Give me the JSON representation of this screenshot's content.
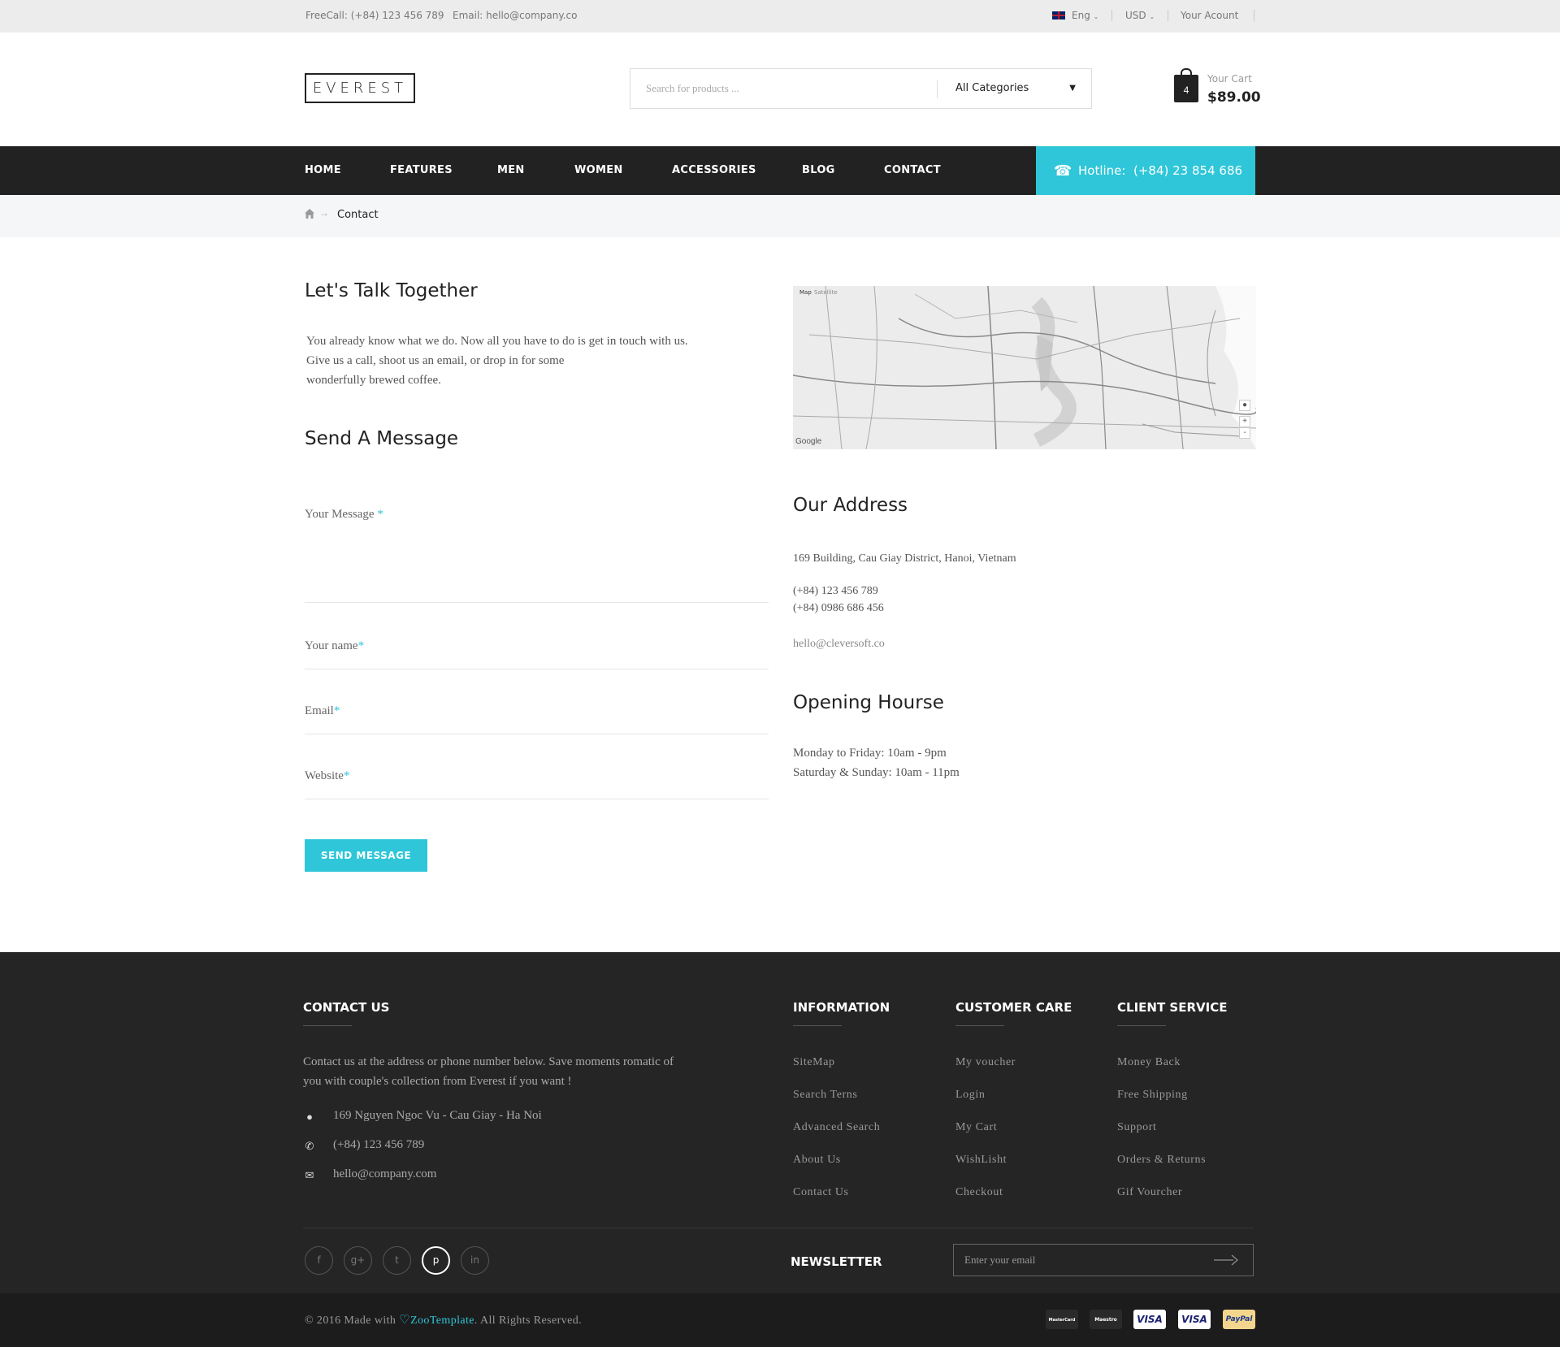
{
  "topbar": {
    "freecall": "FreeCall: (+84) 123 456 789",
    "email": "Email: hello@company.co",
    "language": "Eng",
    "currency": "USD",
    "account": "Your Acount"
  },
  "header": {
    "logo": "EVEREST",
    "search_placeholder": "Search for products ...",
    "category": "All Categories",
    "cart_count": "4",
    "cart_label": "Your Cart",
    "cart_total": "$89.00"
  },
  "nav": {
    "items": [
      "HOME",
      "FEATURES",
      "MEN",
      "WOMEN",
      "ACCESSORIES",
      "BLOG",
      "CONTACT"
    ],
    "hotline_label": "Hotline:",
    "hotline_number": "(+84) 23 854 686"
  },
  "breadcrumb": {
    "current": "Contact"
  },
  "intro": {
    "title": "Let's Talk Together",
    "lines": [
      "You already know what we do. Now all you have to do is get in touch with us.",
      "Give us a call, shoot us an email, or drop in for some",
      "wonderfully brewed coffee."
    ]
  },
  "form": {
    "title": "Send A Message",
    "message_label": "Your Message",
    "name_label": "Your name",
    "email_label": "Email",
    "website_label": "Website",
    "required_mark": "*",
    "submit": "SEND MESSAGE"
  },
  "map": {
    "tab_map": "Map",
    "tab_satellite": "Satellite",
    "google": "Google",
    "zoom_in": "+",
    "zoom_out": "-"
  },
  "address": {
    "title": "Our Address",
    "street": "169 Building, Cau Giay District, Hanoi, Vietnam",
    "phone1": "(+84) 123 456 789",
    "phone2": "(+84) 0986 686 456",
    "email": "hello@cleversoft.co"
  },
  "hours": {
    "title": "Opening Hourse",
    "weekday": "Monday to Friday: 10am - 9pm",
    "weekend": "Saturday & Sunday: 10am - 11pm"
  },
  "footer": {
    "contact": {
      "title": "CONTACT US",
      "text1": "Contact us at the address or phone number below. Save moments romatic of",
      "text2": "you with couple's collection from Everest if you want !",
      "address": "169 Nguyen Ngoc Vu - Cau Giay - Ha Noi",
      "phone": "(+84) 123 456 789",
      "email": "hello@company.com"
    },
    "information": {
      "title": "INFORMATION",
      "links": [
        "SiteMap",
        "Search Terns",
        "Advanced Search",
        "About Us",
        "Contact Us"
      ]
    },
    "customer_care": {
      "title": "CUSTOMER CARE",
      "links": [
        "My voucher",
        "Login",
        "My Cart",
        "WishLisht",
        "Checkout"
      ]
    },
    "client_service": {
      "title": "CLIENT SERVICE",
      "links": [
        "Money Back",
        "Free Shipping",
        "Support",
        "Orders & Returns",
        "Gif Vourcher"
      ]
    },
    "social": [
      "f",
      "g+",
      "t",
      "p",
      "in"
    ],
    "newsletter_label": "NEWSLETTER",
    "newsletter_placeholder": "Enter your email",
    "copyright_pre": "© 2016 Made with",
    "copyright_brand": "ZooTemplate",
    "copyright_post": ". All Rights Reserved.",
    "payments": [
      "MasterCard",
      "Maestro",
      "VISA",
      "VISA",
      "PayPal"
    ]
  },
  "colors": {
    "accent": "#2ec6d8",
    "dark": "#222222",
    "footer_bg": "#252525"
  }
}
